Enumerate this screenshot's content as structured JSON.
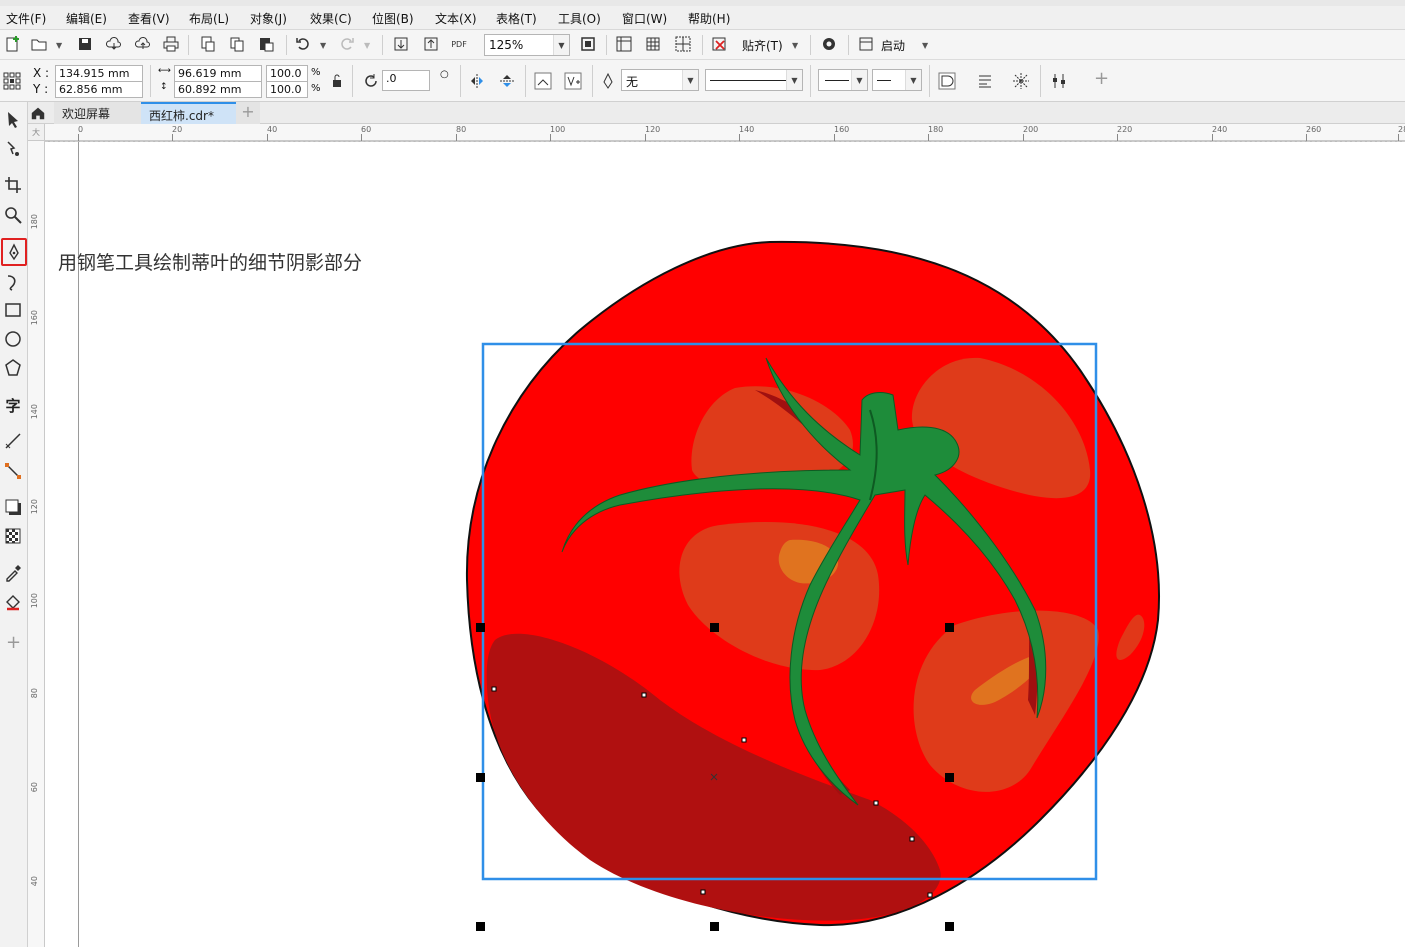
{
  "menu": [
    "文件(F)",
    "编辑(E)",
    "查看(V)",
    "布局(L)",
    "对象(J)",
    "效果(C)",
    "位图(B)",
    "文本(X)",
    "表格(T)",
    "工具(O)",
    "窗口(W)",
    "帮助(H)"
  ],
  "toolbar": {
    "zoom": "125%",
    "snap_label": "贴齐(T)",
    "launch_label": "启动",
    "pdf_label": "PDF"
  },
  "props": {
    "x_label": "X :",
    "y_label": "Y :",
    "x_value": "134.915 mm",
    "y_value": "62.856 mm",
    "width_value": "96.619 mm",
    "height_value": "60.892 mm",
    "scale_w": "100.0",
    "scale_h": "100.0",
    "percent": "%",
    "rotation": ".0",
    "fill_value": "无"
  },
  "tabs": {
    "welcome": "欢迎屏幕",
    "document": "西红柿.cdr*",
    "add": "+"
  },
  "ruler_h": [
    "0",
    "20",
    "40",
    "60",
    "80",
    "100",
    "120",
    "140",
    "160",
    "180",
    "200",
    "220",
    "240",
    "260",
    "28"
  ],
  "ruler_v": [
    "180",
    "160",
    "140",
    "120",
    "100",
    "80",
    "60",
    "40"
  ],
  "ruler_corner": "大",
  "canvas_note": "用钢笔工具绘制蒂叶的细节阴影部分",
  "colors": {
    "tomato": "#ff0000",
    "shadow": "#b01010",
    "highlight": "#d9451e",
    "leaf": "#1e8c3a",
    "selection": "#2f8fe8"
  }
}
